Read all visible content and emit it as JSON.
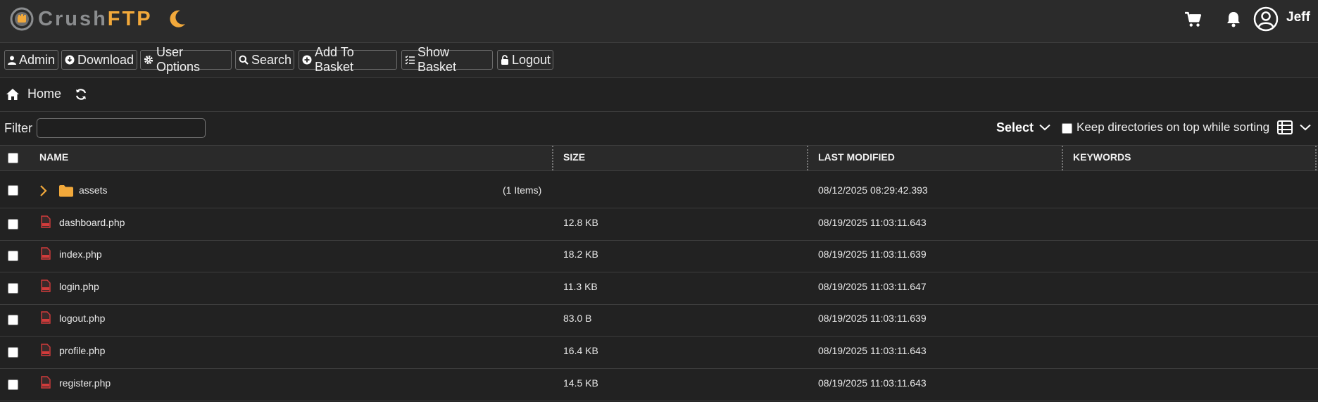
{
  "app": {
    "logo_crush": "Crush",
    "logo_ftp": "FTP",
    "username": "Jeff"
  },
  "toolbar": {
    "admin": "Admin",
    "download": "Download",
    "user_options": "User Options",
    "search": "Search",
    "add_to_basket": "Add To Basket",
    "show_basket": "Show Basket",
    "logout": "Logout"
  },
  "breadcrumb": {
    "home": "Home"
  },
  "filter": {
    "label": "Filter",
    "value": "",
    "select_label": "Select",
    "keep_dirs_label": "Keep directories on top while sorting"
  },
  "table": {
    "headers": {
      "name": "NAME",
      "size": "SIZE",
      "modified": "LAST MODIFIED",
      "keywords": "KEYWORDS"
    },
    "rows": [
      {
        "name": "assets",
        "items": "(1 Items)",
        "size": "",
        "modified": "08/12/2025 08:29:42.393",
        "type": "folder"
      },
      {
        "name": "dashboard.php",
        "size": "12.8 KB",
        "modified": "08/19/2025 11:03:11.643",
        "type": "file"
      },
      {
        "name": "index.php",
        "size": "18.2 KB",
        "modified": "08/19/2025 11:03:11.639",
        "type": "file"
      },
      {
        "name": "login.php",
        "size": "11.3 KB",
        "modified": "08/19/2025 11:03:11.647",
        "type": "file"
      },
      {
        "name": "logout.php",
        "size": "83.0 B",
        "modified": "08/19/2025 11:03:11.639",
        "type": "file"
      },
      {
        "name": "profile.php",
        "size": "16.4 KB",
        "modified": "08/19/2025 11:03:11.643",
        "type": "file"
      },
      {
        "name": "register.php",
        "size": "14.5 KB",
        "modified": "08/19/2025 11:03:11.643",
        "type": "file"
      }
    ]
  },
  "colors": {
    "accent": "#f2a93b",
    "file_icon": "#d23b3b",
    "background": "#222222"
  }
}
